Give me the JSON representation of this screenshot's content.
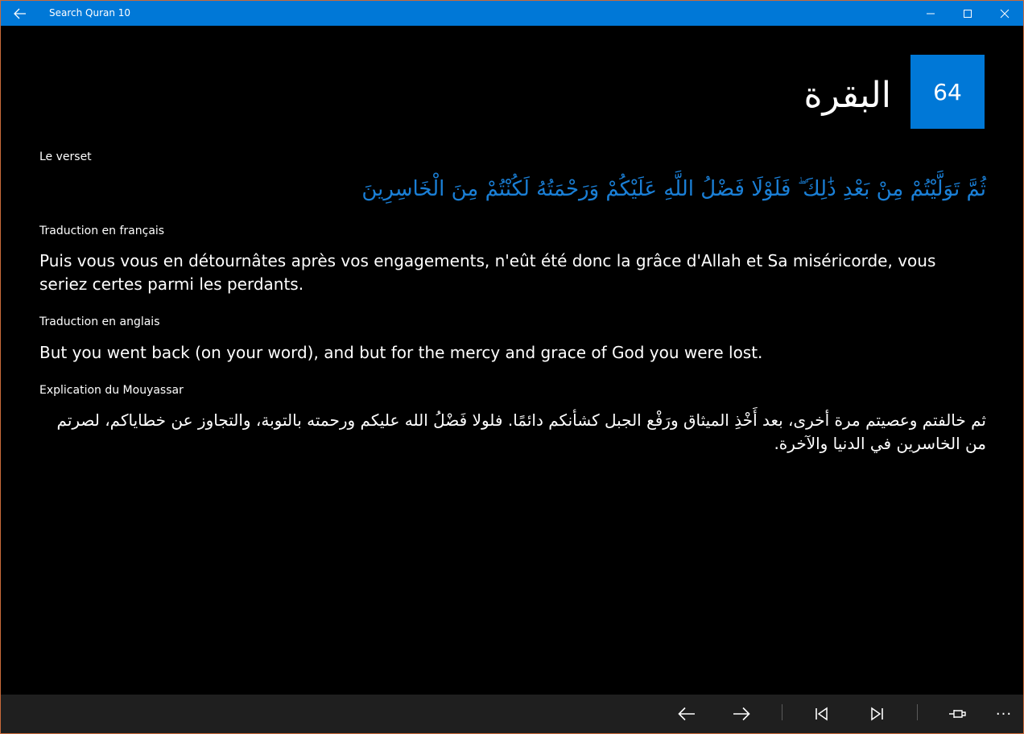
{
  "window": {
    "title": "Search Quran 10",
    "accent_color": "#0078d7"
  },
  "header": {
    "surah_name": "البقرة",
    "verse_number": "64"
  },
  "sections": {
    "verse_label": "Le verset",
    "verse_text": "ثُمَّ تَوَلَّيْتُمْ مِنْ بَعْدِ ذَٰلِكَ ۖ فَلَوْلَا فَضْلُ اللَّهِ عَلَيْكُمْ وَرَحْمَتُهُ لَكُنْتُمْ مِنَ الْخَاسِرِينَ",
    "fr_label": "Traduction en français",
    "fr_text": "Puis vous vous en détournâtes après vos engagements, n'eût été donc la grâce d'Allah et Sa miséricorde, vous seriez certes parmi les perdants.",
    "en_label": "Traduction en anglais",
    "en_text": "But you went back (on your word), and but for the mercy and grace of God you were lost.",
    "expl_label": "Explication du Mouyassar",
    "expl_text": "ثم خالفتم وعصيتم مرة أخرى، بعد أَخْذِ الميثاق ورَفْع الجبل كشأنكم دائمًا. فلولا فَضْلُ الله عليكم ورحمته بالتوبة، والتجاوز عن خطاياكم، لصرتم من الخاسرين في الدنيا والآخرة."
  },
  "commandbar": {
    "icons": [
      "arrow-left-icon",
      "arrow-right-icon",
      "first-icon",
      "last-icon",
      "pin-icon",
      "more-icon"
    ],
    "more_label": "···"
  }
}
